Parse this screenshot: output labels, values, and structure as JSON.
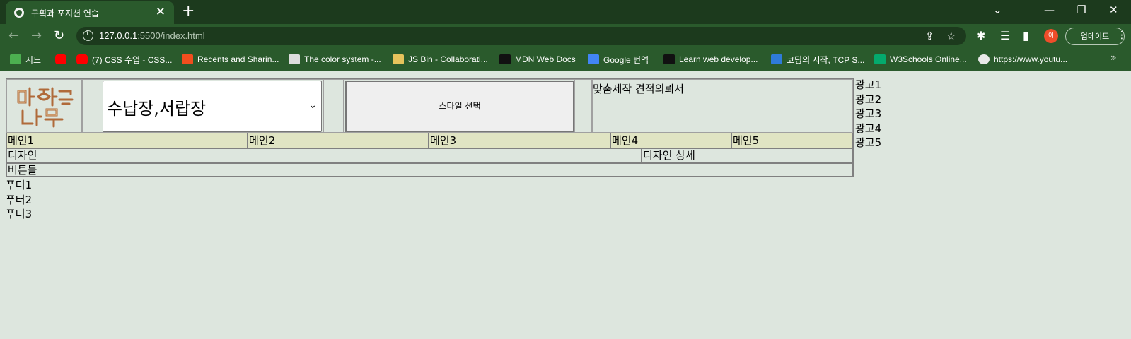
{
  "browser": {
    "tab": {
      "title": "구획과 포지션 연습",
      "close": "✕"
    },
    "new_tab": "+",
    "window_controls": {
      "tabsearch": "⌄",
      "minimize": "—",
      "restore": "❐",
      "close": "✕"
    },
    "nav": {
      "back": "←",
      "forward": "→",
      "reload": "↻"
    },
    "url": {
      "host": "127.0.0.1",
      "path": ":5500/index.html"
    },
    "toolbar_icons": {
      "share": "⇪",
      "star": "☆",
      "extensions": "✱",
      "reading_list": "☰",
      "sidepanel": "▮"
    },
    "profile_initial": "이",
    "update_button": "업데이트",
    "menu": "⋮",
    "bookmarks": [
      {
        "label": "지도",
        "icon": "maps-icon",
        "color": "#4caf50"
      },
      {
        "label": "",
        "icon": "youtube-icon",
        "color": "#ff0000"
      },
      {
        "label": "(7) CSS 수업 - CSS...",
        "icon": "youtube-icon",
        "color": "#ff0000"
      },
      {
        "label": "Recents and Sharin...",
        "icon": "figma-icon",
        "color": "#f24e1e"
      },
      {
        "label": "The color system -...",
        "icon": "material-icon",
        "color": "#dddddd"
      },
      {
        "label": "JS Bin - Collaborati...",
        "icon": "jsbin-icon",
        "color": "#e6c35c"
      },
      {
        "label": "MDN Web Docs",
        "icon": "mdn-icon",
        "color": "#111111"
      },
      {
        "label": "Google 번역",
        "icon": "google-translate-icon",
        "color": "#4285f4"
      },
      {
        "label": "Learn web develop...",
        "icon": "mdn-icon",
        "color": "#111111"
      },
      {
        "label": "코딩의 시작, TCP S...",
        "icon": "tcp-icon",
        "color": "#2f7bd9"
      },
      {
        "label": "W3Schools Online...",
        "icon": "w3schools-icon",
        "color": "#04aa6d"
      },
      {
        "label": "https://www.youtu...",
        "icon": "globe-icon",
        "color": "#e8e8e8"
      }
    ],
    "bookmarks_more": "»"
  },
  "page": {
    "logo_text": "말하는 나무",
    "style_select": {
      "selected": "수납장,서랍장"
    },
    "style_button": "스타일 선택",
    "order_form": "맞춤제작 견적의뢰서",
    "menus": [
      "메인1",
      "메인2",
      "메인3",
      "메인4",
      "메인5"
    ],
    "design": "디자인",
    "design_detail": "디자인 상세",
    "buttons": "버튼들",
    "ads": [
      "광고1",
      "광고2",
      "광고3",
      "광고4",
      "광고5"
    ],
    "footers": [
      "푸터1",
      "푸터2",
      "푸터3"
    ]
  },
  "colors": {
    "page_bg": "#dde6de",
    "menu_row_bg": "#e0e4c3",
    "chrome_dark": "#1c3a1d",
    "chrome_light": "#2a5a2c"
  }
}
